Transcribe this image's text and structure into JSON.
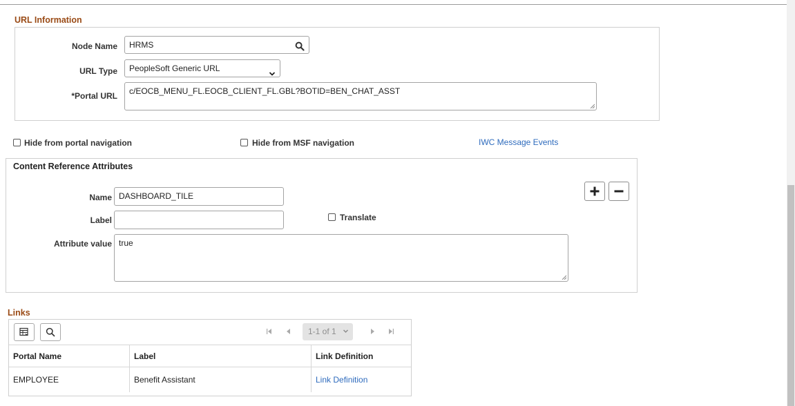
{
  "url_info": {
    "title": "URL Information",
    "node_name_label": "Node Name",
    "node_name_value": "HRMS",
    "url_type_label": "URL Type",
    "url_type_value": "PeopleSoft Generic URL",
    "portal_url_label": "*Portal URL",
    "portal_url_value": "c/EOCB_MENU_FL.EOCB_CLIENT_FL.GBL?BOTID=BEN_CHAT_ASST"
  },
  "options": {
    "hide_portal_nav": "Hide from portal navigation",
    "hide_msf_nav": "Hide from MSF navigation",
    "iwc_link": "IWC Message Events"
  },
  "cref_attributes": {
    "title": "Content Reference Attributes",
    "name_label": "Name",
    "name_value": "DASHBOARD_TILE",
    "label_label": "Label",
    "label_value": "",
    "translate_label": "Translate",
    "attr_value_label": "Attribute value",
    "attr_value": "true"
  },
  "links": {
    "title": "Links",
    "pagination": "1-1 of 1",
    "columns": [
      "Portal Name",
      "Label",
      "Link Definition"
    ],
    "rows": [
      {
        "portal_name": "EMPLOYEE",
        "label": "Benefit Assistant",
        "link_definition": "Link Definition"
      }
    ]
  },
  "icons": [
    "search-icon",
    "chevron-down-icon",
    "add-icon",
    "remove-icon",
    "personalize-grid-icon",
    "find-icon",
    "first-page-icon",
    "previous-page-icon",
    "next-page-icon",
    "last-page-icon"
  ]
}
